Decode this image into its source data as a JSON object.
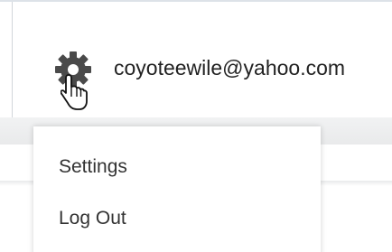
{
  "account": {
    "email": "coyoteewile@yahoo.com",
    "icon": "gear-icon"
  },
  "menu": {
    "items": [
      {
        "label": "Settings"
      },
      {
        "label": "Log Out"
      }
    ]
  },
  "cursor": {
    "type": "hand-pointer"
  },
  "colors": {
    "icon": "#4a4a4a",
    "text": "#222222"
  }
}
